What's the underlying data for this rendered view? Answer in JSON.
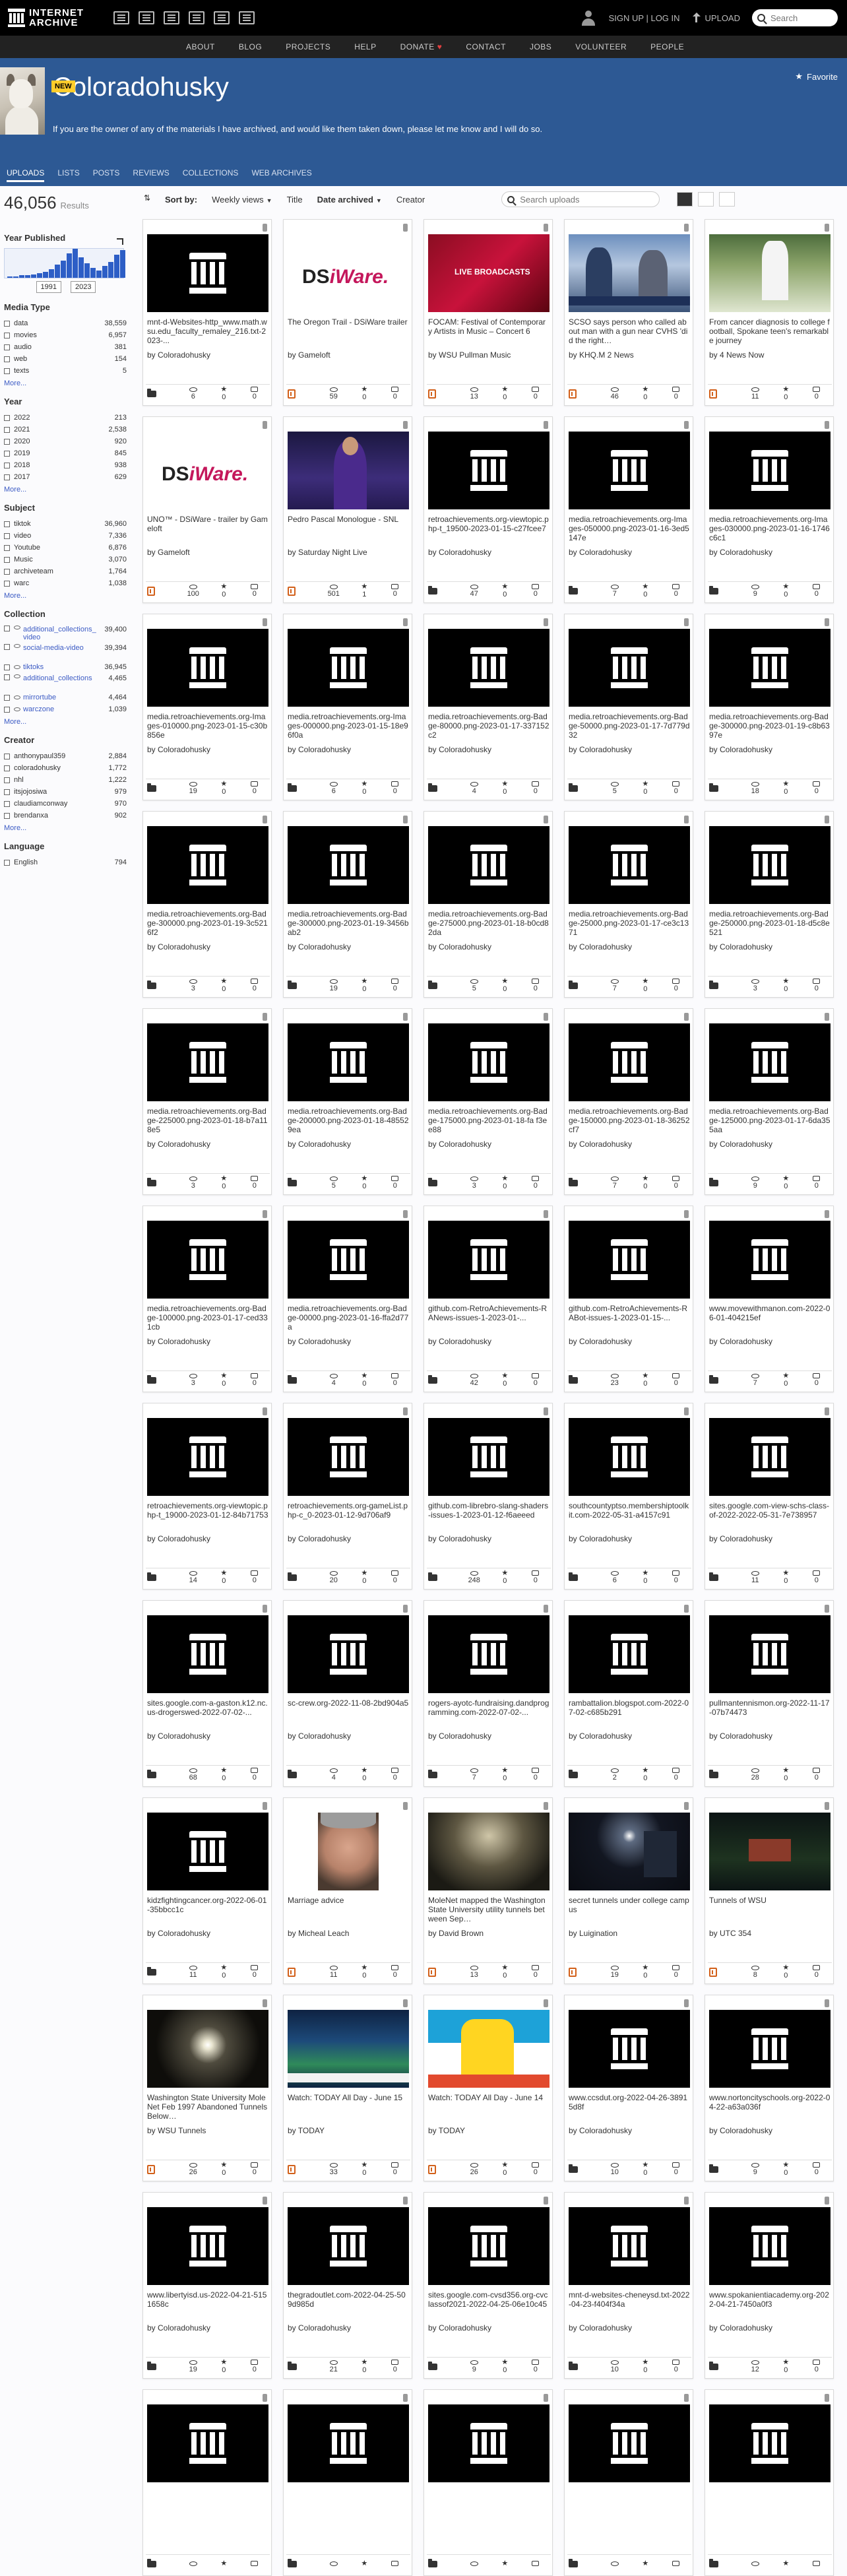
{
  "nav": {
    "logo_line1": "INTERNET",
    "logo_line2": "ARCHIVE",
    "sign_in": "SIGN UP | LOG IN",
    "upload": "UPLOAD",
    "search_placeholder": "Search"
  },
  "subnav": [
    "ABOUT",
    "BLOG",
    "PROJECTS",
    "HELP",
    "DONATE",
    "CONTACT",
    "JOBS",
    "VOLUNTEER",
    "PEOPLE"
  ],
  "banner": {
    "title": "Coloradohusky",
    "description": "If you are the owner of any of the materials I have archived, and would like them taken down, please let me know and I will do so.",
    "favorite": "Favorite",
    "new_badge": "NEW",
    "tabs": [
      "UPLOADS",
      "LISTS",
      "POSTS",
      "REVIEWS",
      "COLLECTIONS",
      "WEB ARCHIVES"
    ]
  },
  "sidebar": {
    "results_count": "46,056",
    "results_label": "Results",
    "year_published_title": "Year Published",
    "year_from": "1991",
    "year_to": "2023",
    "year_bar_levels": [
      0.05,
      0.05,
      0.08,
      0.1,
      0.12,
      0.15,
      0.2,
      0.3,
      0.45,
      0.6,
      0.85,
      1.0,
      0.7,
      0.5,
      0.35,
      0.25,
      0.4,
      0.55,
      0.8,
      0.95
    ],
    "more": "More...",
    "media_type": {
      "title": "Media Type",
      "items": [
        {
          "label": "data",
          "count": "38,559"
        },
        {
          "label": "movies",
          "count": "6,957"
        },
        {
          "label": "audio",
          "count": "381"
        },
        {
          "label": "web",
          "count": "154"
        },
        {
          "label": "texts",
          "count": "5"
        }
      ]
    },
    "year": {
      "title": "Year",
      "items": [
        {
          "label": "2022",
          "count": "213"
        },
        {
          "label": "2021",
          "count": "2,538"
        },
        {
          "label": "2020",
          "count": "920"
        },
        {
          "label": "2019",
          "count": "845"
        },
        {
          "label": "2018",
          "count": "938"
        },
        {
          "label": "2017",
          "count": "629"
        }
      ]
    },
    "subject": {
      "title": "Subject",
      "items": [
        {
          "label": "tiktok",
          "count": "36,960"
        },
        {
          "label": "video",
          "count": "7,336"
        },
        {
          "label": "Youtube",
          "count": "6,876"
        },
        {
          "label": "Music",
          "count": "3,070"
        },
        {
          "label": "archiveteam",
          "count": "1,764"
        },
        {
          "label": "warc",
          "count": "1,038"
        }
      ]
    },
    "collection": {
      "title": "Collection",
      "items": [
        {
          "label": "additional_collections_video",
          "count": "39,400"
        },
        {
          "label": "social-media-video",
          "count": "39,394"
        },
        {
          "label": "tiktoks",
          "count": "36,945"
        },
        {
          "label": "additional_collections",
          "count": "4,465"
        },
        {
          "label": "mirrortube",
          "count": "4,464"
        },
        {
          "label": "warczone",
          "count": "1,039"
        }
      ]
    },
    "creator": {
      "title": "Creator",
      "items": [
        {
          "label": "anthonypaul359",
          "count": "2,884"
        },
        {
          "label": "coloradohusky",
          "count": "1,772"
        },
        {
          "label": "nhl",
          "count": "1,222"
        },
        {
          "label": "itsjojosiwa",
          "count": "979"
        },
        {
          "label": "claudiamconway",
          "count": "970"
        },
        {
          "label": "brendanxa",
          "count": "902"
        }
      ]
    },
    "language": {
      "title": "Language",
      "items": [
        {
          "label": "English",
          "count": "794"
        }
      ]
    }
  },
  "sortbar": {
    "label": "Sort by:",
    "weekly_views": "Weekly views",
    "title": "Title",
    "date_archived": "Date archived",
    "creator": "Creator",
    "search_placeholder": "Search uploads"
  },
  "items": [
    {
      "title": "mnt-d-Websites-http_www.math.wsu.edu_faculty_remaley_216.txt-2023-...",
      "by": "by Coloradohusky",
      "type": "folder",
      "thumb": "ia",
      "views": "6",
      "favs": "0",
      "reviews": "0"
    },
    {
      "title": "The Oregon Trail - DSiWare trailer",
      "by": "by Gameloft",
      "type": "movie",
      "thumb": "dsiware",
      "views": "59",
      "favs": "0",
      "reviews": "0"
    },
    {
      "title": "FOCAM: Festival of Contemporary Artists in Music – Concert 6",
      "by": "by WSU Pullman Music",
      "type": "movie",
      "thumb": "live",
      "thumb_text": "LIVE BROADCASTS",
      "views": "13",
      "favs": "0",
      "reviews": "0"
    },
    {
      "title": "SCSO says person who called about man with a gun near CVHS 'did the right…",
      "by": "by KHQ.M 2 News",
      "type": "movie",
      "thumb": "news",
      "views": "46",
      "favs": "0",
      "reviews": "0"
    },
    {
      "title": "From cancer diagnosis to college football, Spokane teen's remarkable journey",
      "by": "by 4 News Now",
      "type": "movie",
      "thumb": "field",
      "views": "11",
      "favs": "0",
      "reviews": "0"
    },
    {
      "title": "UNO™ - DSiWare - trailer by Gameloft",
      "by": "by Gameloft",
      "type": "movie",
      "thumb": "dsiware",
      "views": "100",
      "favs": "0",
      "reviews": "0"
    },
    {
      "title": "Pedro Pascal Monologue - SNL",
      "by": "by Saturday Night Live",
      "type": "movie",
      "thumb": "snl",
      "views": "501",
      "favs": "1",
      "reviews": "0"
    },
    {
      "title": "retroachievements.org-viewtopic.php-t_19500-2023-01-15-c27fcee7",
      "by": "by Coloradohusky",
      "type": "folder",
      "thumb": "ia",
      "views": "47",
      "favs": "0",
      "reviews": "0"
    },
    {
      "title": "media.retroachievements.org-Images-050000.png-2023-01-16-3ed5147e",
      "by": "by Coloradohusky",
      "type": "folder",
      "thumb": "ia",
      "views": "7",
      "favs": "0",
      "reviews": "0"
    },
    {
      "title": "media.retroachievements.org-Images-030000.png-2023-01-16-1746c6c1",
      "by": "by Coloradohusky",
      "type": "folder",
      "thumb": "ia",
      "views": "9",
      "favs": "0",
      "reviews": "0"
    },
    {
      "title": "media.retroachievements.org-Images-010000.png-2023-01-15-c30b856e",
      "by": "by Coloradohusky",
      "type": "folder",
      "thumb": "ia",
      "views": "19",
      "favs": "0",
      "reviews": "0"
    },
    {
      "title": "media.retroachievements.org-Images-000000.png-2023-01-15-18e96f0a",
      "by": "by Coloradohusky",
      "type": "folder",
      "thumb": "ia",
      "views": "6",
      "favs": "0",
      "reviews": "0"
    },
    {
      "title": "media.retroachievements.org-Badge-80000.png-2023-01-17-337152c2",
      "by": "by Coloradohusky",
      "type": "folder",
      "thumb": "ia",
      "views": "4",
      "favs": "0",
      "reviews": "0"
    },
    {
      "title": "media.retroachievements.org-Badge-50000.png-2023-01-17-7d779d32",
      "by": "by Coloradohusky",
      "type": "folder",
      "thumb": "ia",
      "views": "5",
      "favs": "0",
      "reviews": "0"
    },
    {
      "title": "media.retroachievements.org-Badge-300000.png-2023-01-19-c8b6397e",
      "by": "by Coloradohusky",
      "type": "folder",
      "thumb": "ia",
      "views": "18",
      "favs": "0",
      "reviews": "0"
    },
    {
      "title": "media.retroachievements.org-Badge-300000.png-2023-01-19-3c5216f2",
      "by": "by Coloradohusky",
      "type": "folder",
      "thumb": "ia",
      "views": "3",
      "favs": "0",
      "reviews": "0"
    },
    {
      "title": "media.retroachievements.org-Badge-300000.png-2023-01-19-3456bab2",
      "by": "by Coloradohusky",
      "type": "folder",
      "thumb": "ia",
      "views": "19",
      "favs": "0",
      "reviews": "0"
    },
    {
      "title": "media.retroachievements.org-Badge-275000.png-2023-01-18-b0cd82da",
      "by": "by Coloradohusky",
      "type": "folder",
      "thumb": "ia",
      "views": "5",
      "favs": "0",
      "reviews": "0"
    },
    {
      "title": "media.retroachievements.org-Badge-25000.png-2023-01-17-ce3c1371",
      "by": "by Coloradohusky",
      "type": "folder",
      "thumb": "ia",
      "views": "7",
      "favs": "0",
      "reviews": "0"
    },
    {
      "title": "media.retroachievements.org-Badge-250000.png-2023-01-18-d5c8e521",
      "by": "by Coloradohusky",
      "type": "folder",
      "thumb": "ia",
      "views": "3",
      "favs": "0",
      "reviews": "0"
    },
    {
      "title": "media.retroachievements.org-Badge-225000.png-2023-01-18-b7a118e5",
      "by": "by Coloradohusky",
      "type": "folder",
      "thumb": "ia",
      "views": "3",
      "favs": "0",
      "reviews": "0"
    },
    {
      "title": "media.retroachievements.org-Badge-200000.png-2023-01-18-485529ea",
      "by": "by Coloradohusky",
      "type": "folder",
      "thumb": "ia",
      "views": "5",
      "favs": "0",
      "reviews": "0"
    },
    {
      "title": "media.retroachievements.org-Badge-175000.png-2023-01-18-fa f3ee88",
      "by": "by Coloradohusky",
      "type": "folder",
      "thumb": "ia",
      "views": "3",
      "favs": "0",
      "reviews": "0"
    },
    {
      "title": "media.retroachievements.org-Badge-150000.png-2023-01-18-36252cf7",
      "by": "by Coloradohusky",
      "type": "folder",
      "thumb": "ia",
      "views": "7",
      "favs": "0",
      "reviews": "0"
    },
    {
      "title": "media.retroachievements.org-Badge-125000.png-2023-01-17-6da355aa",
      "by": "by Coloradohusky",
      "type": "folder",
      "thumb": "ia",
      "views": "9",
      "favs": "0",
      "reviews": "0"
    },
    {
      "title": "media.retroachievements.org-Badge-100000.png-2023-01-17-ced331cb",
      "by": "by Coloradohusky",
      "type": "folder",
      "thumb": "ia",
      "views": "3",
      "favs": "0",
      "reviews": "0"
    },
    {
      "title": "media.retroachievements.org-Badge-00000.png-2023-01-16-ffa2d77a",
      "by": "by Coloradohusky",
      "type": "folder",
      "thumb": "ia",
      "views": "4",
      "favs": "0",
      "reviews": "0"
    },
    {
      "title": "github.com-RetroAchievements-RANews-issues-1-2023-01-...",
      "by": "by Coloradohusky",
      "type": "folder",
      "thumb": "ia",
      "views": "42",
      "favs": "0",
      "reviews": "0"
    },
    {
      "title": "github.com-RetroAchievements-RABot-issues-1-2023-01-15-...",
      "by": "by Coloradohusky",
      "type": "folder",
      "thumb": "ia",
      "views": "23",
      "favs": "0",
      "reviews": "0"
    },
    {
      "title": "www.movewithmanon.com-2022-06-01-404215ef",
      "by": "by Coloradohusky",
      "type": "folder",
      "thumb": "ia",
      "views": "7",
      "favs": "0",
      "reviews": "0"
    },
    {
      "title": "retroachievements.org-viewtopic.php-t_19000-2023-01-12-84b71753",
      "by": "by Coloradohusky",
      "type": "folder",
      "thumb": "ia",
      "views": "14",
      "favs": "0",
      "reviews": "0"
    },
    {
      "title": "retroachievements.org-gameList.php-c_0-2023-01-12-9d706af9",
      "by": "by Coloradohusky",
      "type": "folder",
      "thumb": "ia",
      "views": "20",
      "favs": "0",
      "reviews": "0"
    },
    {
      "title": "github.com-librebro-slang-shaders-issues-1-2023-01-12-f6aeeed",
      "by": "by Coloradohusky",
      "type": "folder",
      "thumb": "ia",
      "views": "248",
      "favs": "0",
      "reviews": "0"
    },
    {
      "title": "southcountyptso.membershiptoolkit.com-2022-05-31-a4157c91",
      "by": "by Coloradohusky",
      "type": "folder",
      "thumb": "ia",
      "views": "6",
      "favs": "0",
      "reviews": "0"
    },
    {
      "title": "sites.google.com-view-schs-class-of-2022-2022-05-31-7e738957",
      "by": "by Coloradohusky",
      "type": "folder",
      "thumb": "ia",
      "views": "11",
      "favs": "0",
      "reviews": "0"
    },
    {
      "title": "sites.google.com-a-gaston.k12.nc.us-drogerswed-2022-07-02-...",
      "by": "by Coloradohusky",
      "type": "folder",
      "thumb": "ia",
      "views": "68",
      "favs": "0",
      "reviews": "0"
    },
    {
      "title": "sc-crew.org-2022-11-08-2bd904a5",
      "by": "by Coloradohusky",
      "type": "folder",
      "thumb": "ia",
      "views": "4",
      "favs": "0",
      "reviews": "0"
    },
    {
      "title": "rogers-ayotc-fundraising.dandprogramming.com-2022-07-02-...",
      "by": "by Coloradohusky",
      "type": "folder",
      "thumb": "ia",
      "views": "7",
      "favs": "0",
      "reviews": "0"
    },
    {
      "title": "rambattalion.blogspot.com-2022-07-02-c685b291",
      "by": "by Coloradohusky",
      "type": "folder",
      "thumb": "ia",
      "views": "2",
      "favs": "0",
      "reviews": "0"
    },
    {
      "title": "pullmantennismon.org-2022-11-17-07b74473",
      "by": "by Coloradohusky",
      "type": "folder",
      "thumb": "ia",
      "views": "28",
      "favs": "0",
      "reviews": "0"
    },
    {
      "title": "kidzfightingcancer.org-2022-06-01-35bbcc1c",
      "by": "by Coloradohusky",
      "type": "folder",
      "thumb": "ia",
      "views": "11",
      "favs": "0",
      "reviews": "0"
    },
    {
      "title": "Marriage advice",
      "by": "by Micheal Leach",
      "type": "movie",
      "thumb": "face",
      "views": "11",
      "favs": "0",
      "reviews": "0"
    },
    {
      "title": "MoleNet mapped the Washington State University utility tunnels between Sep…",
      "by": "by David Brown",
      "type": "movie",
      "thumb": "tunnel",
      "views": "13",
      "favs": "0",
      "reviews": "0"
    },
    {
      "title": "secret tunnels under college campus",
      "by": "by Luigination",
      "type": "movie",
      "thumb": "night",
      "views": "19",
      "favs": "0",
      "reviews": "0"
    },
    {
      "title": "Tunnels of WSU",
      "by": "by UTC 354",
      "type": "movie",
      "thumb": "campus",
      "views": "8",
      "favs": "0",
      "reviews": "0"
    },
    {
      "title": "Washington State University MoleNet Feb 1997 Abandoned Tunnels Below…",
      "by": "by WSU Tunnels",
      "type": "movie",
      "thumb": "flash",
      "views": "26",
      "favs": "0",
      "reviews": "0"
    },
    {
      "title": "Watch: TODAY All Day - June 15",
      "by": "by TODAY",
      "type": "movie",
      "thumb": "tennis",
      "views": "33",
      "favs": "0",
      "reviews": "0"
    },
    {
      "title": "Watch: TODAY All Day - June 14",
      "by": "by TODAY",
      "type": "movie",
      "thumb": "cartoon",
      "views": "26",
      "favs": "0",
      "reviews": "0"
    },
    {
      "title": "www.ccsdut.org-2022-04-26-38915d8f",
      "by": "by Coloradohusky",
      "type": "folder",
      "thumb": "ia",
      "views": "10",
      "favs": "0",
      "reviews": "0"
    },
    {
      "title": "www.nortoncityschools.org-2022-04-22-a63a036f",
      "by": "by Coloradohusky",
      "type": "folder",
      "thumb": "ia",
      "views": "9",
      "favs": "0",
      "reviews": "0"
    },
    {
      "title": "www.libertyisd.us-2022-04-21-5151658c",
      "by": "by Coloradohusky",
      "type": "folder",
      "thumb": "ia",
      "views": "19",
      "favs": "0",
      "reviews": "0"
    },
    {
      "title": "thegradoutlet.com-2022-04-25-509d985d",
      "by": "by Coloradohusky",
      "type": "folder",
      "thumb": "ia",
      "views": "21",
      "favs": "0",
      "reviews": "0"
    },
    {
      "title": "sites.google.com-cvsd356.org-cvclassof2021-2022-04-25-06e10c45",
      "by": "by Coloradohusky",
      "type": "folder",
      "thumb": "ia",
      "views": "9",
      "favs": "0",
      "reviews": "0"
    },
    {
      "title": "mnt-d-websites-cheneysd.txt-2022-04-23-f404f34a",
      "by": "by Coloradohusky",
      "type": "folder",
      "thumb": "ia",
      "views": "10",
      "favs": "0",
      "reviews": "0"
    },
    {
      "title": "www.spokanientiacademy.org-2022-04-21-7450a0f3",
      "by": "by Coloradohusky",
      "type": "folder",
      "thumb": "ia",
      "views": "12",
      "favs": "0",
      "reviews": "0"
    },
    {
      "title": "",
      "by": "",
      "type": "folder",
      "thumb": "ia",
      "views": "",
      "favs": "",
      "reviews": ""
    },
    {
      "title": "",
      "by": "",
      "type": "folder",
      "thumb": "ia",
      "views": "",
      "favs": "",
      "reviews": ""
    },
    {
      "title": "",
      "by": "",
      "type": "folder",
      "thumb": "ia",
      "views": "",
      "favs": "",
      "reviews": ""
    },
    {
      "title": "",
      "by": "",
      "type": "folder",
      "thumb": "ia",
      "views": "",
      "favs": "",
      "reviews": ""
    },
    {
      "title": "",
      "by": "",
      "type": "folder",
      "thumb": "ia",
      "views": "",
      "favs": "",
      "reviews": ""
    }
  ]
}
